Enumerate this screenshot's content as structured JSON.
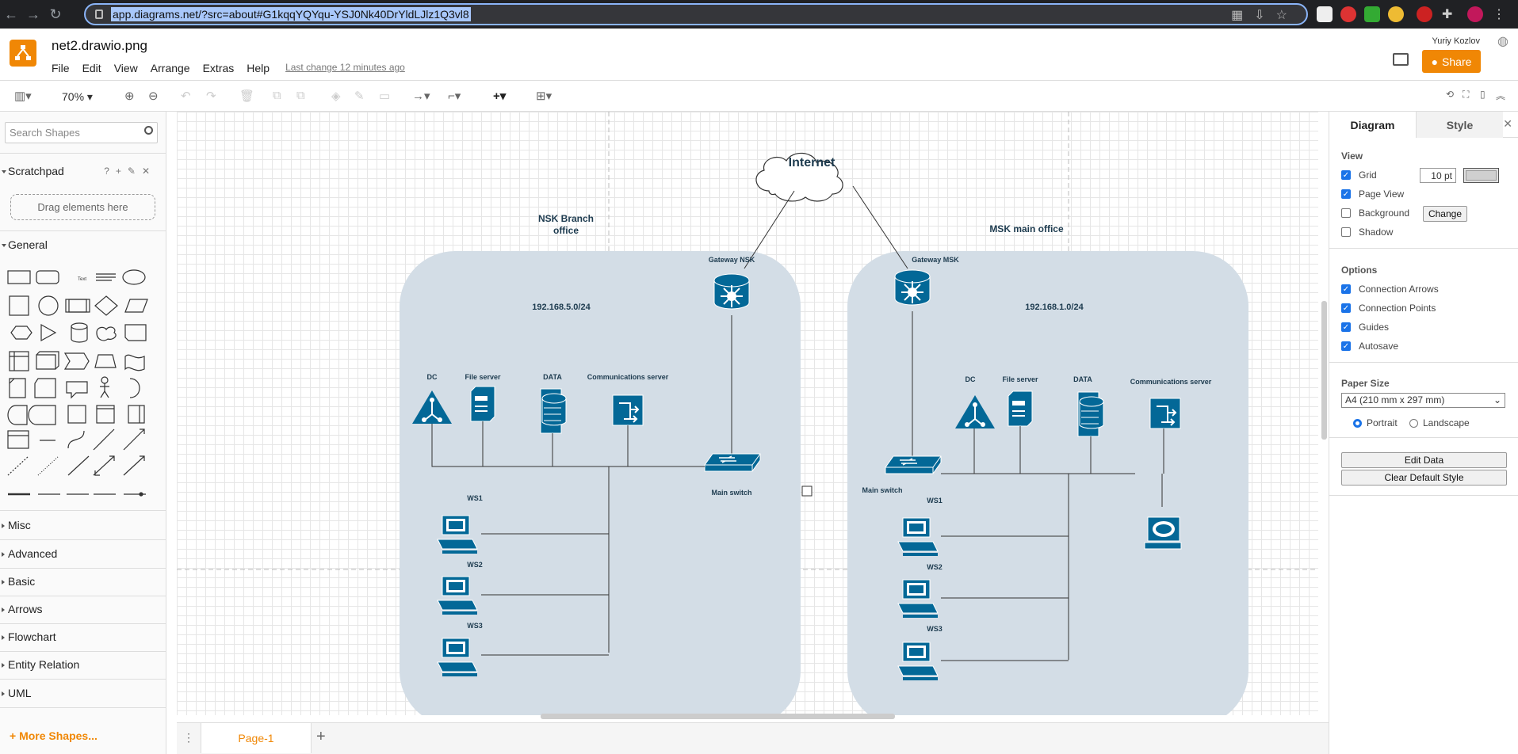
{
  "browser": {
    "url": "app.diagrams.net/?src=about#G1kqqYQYqu-YSJ0Nk40DrYldLJlz1Q3vl8"
  },
  "app": {
    "file_title": "net2.drawio.png",
    "menu": [
      "File",
      "Edit",
      "View",
      "Arrange",
      "Extras",
      "Help"
    ],
    "last_change": "Last change 12 minutes ago",
    "user_name": "Yuriy Kozlov",
    "share_label": "Share"
  },
  "toolbar": {
    "zoom": "70%"
  },
  "sidebar": {
    "search_placeholder": "Search Shapes",
    "scratchpad_label": "Scratchpad",
    "drag_hint": "Drag elements here",
    "general_label": "General",
    "sections": [
      "Misc",
      "Advanced",
      "Basic",
      "Arrows",
      "Flowchart",
      "Entity Relation",
      "UML"
    ],
    "more_shapes": "+ More Shapes..."
  },
  "pages": {
    "current": "Page-1"
  },
  "diagram": {
    "internet_label": "Internet",
    "nsk": {
      "title": "NSK Branch office",
      "gateway": "Gateway NSK",
      "subnet": "192.168.5.0/24",
      "servers": [
        "DC",
        "File server",
        "DATA",
        "Communications server"
      ],
      "switch": "Main switch",
      "workstations": [
        "WS1",
        "WS2",
        "WS3"
      ]
    },
    "msk": {
      "title": "MSK main office",
      "gateway": "Gateway MSK",
      "subnet": "192.168.1.0/24",
      "servers": [
        "DC",
        "File server",
        "DATA",
        "Communications server"
      ],
      "switch": "Main switch",
      "workstations": [
        "WS1",
        "WS2",
        "WS3"
      ]
    }
  },
  "format_panel": {
    "tabs": [
      "Diagram",
      "Style"
    ],
    "view_heading": "View",
    "grid_label": "Grid",
    "grid_size": "10 pt",
    "page_view_label": "Page View",
    "background_label": "Background",
    "change_label": "Change",
    "shadow_label": "Shadow",
    "options_heading": "Options",
    "options": [
      "Connection Arrows",
      "Connection Points",
      "Guides",
      "Autosave"
    ],
    "paper_heading": "Paper Size",
    "paper_size": "A4 (210 mm x 297 mm)",
    "portrait_label": "Portrait",
    "landscape_label": "Landscape",
    "edit_data_label": "Edit Data",
    "clear_style_label": "Clear Default Style"
  },
  "colors": {
    "accent": "#f08705",
    "network_blue": "#036897",
    "zone_fill": "#d3dde6"
  }
}
